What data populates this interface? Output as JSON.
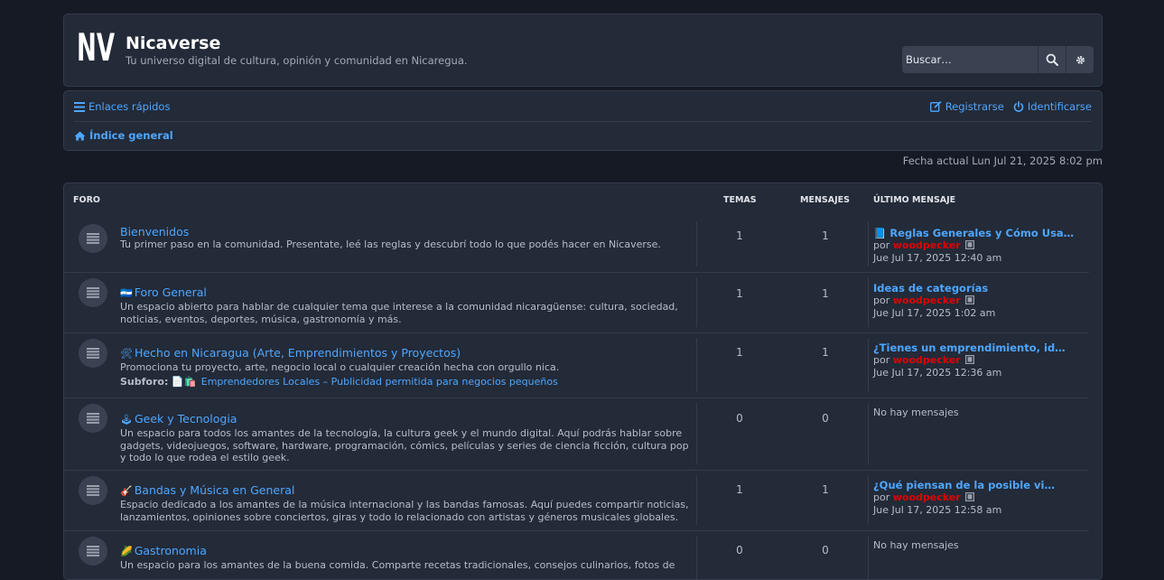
{
  "header": {
    "logo_text": "NV",
    "site_title": "Nicaverse",
    "site_description": "Tu universo digital de cultura, opinión y comunidad en Nicaregua.",
    "search_placeholder": "Buscar…"
  },
  "navbar": {
    "quick_links": "Enlaces rápidos",
    "register": "Registrarse",
    "login": "Identificarse",
    "breadcrumb": "Índice general"
  },
  "current_time": "Fecha actual Lun Jul 21, 2025 8:02 pm",
  "table": {
    "col_forum": "FORO",
    "col_topics": "TEMAS",
    "col_posts": "MENSAJES",
    "col_last": "ÚLTIMO MENSAJE"
  },
  "forums": [
    {
      "emoji": "",
      "title": "Bienvenidos",
      "description": "Tu primer paso en la comunidad. Presentate, leé las reglas y descubrí todo lo que podés hacer en Nicaverse.",
      "topics": "1",
      "posts": "1",
      "last_title": "📘 Reglas Generales y Cómo Usa…",
      "by": "por",
      "last_author": "woodpecker",
      "last_date": "Jue Jul 17, 2025 12:40 am"
    },
    {
      "emoji": "🇳🇮",
      "title": "Foro General",
      "description": "Un espacio abierto para hablar de cualquier tema que interese a la comunidad nicaragüense: cultura, sociedad, noticias, eventos, deportes, música, gastronomía y más.",
      "topics": "1",
      "posts": "1",
      "last_title": "Ideas de categorías",
      "by": "por",
      "last_author": "woodpecker",
      "last_date": "Jue Jul 17, 2025 1:02 am"
    },
    {
      "emoji": "🛠",
      "title": "Hecho en Nicaragua (Arte, Emprendimientos y Proyectos)",
      "description": "Promociona tu proyecto, arte, negocio local o cualquier creación hecha con orgullo nica.",
      "subforum_label": "Subforo:",
      "subforum_emoji": "📄🛍️",
      "subforum_link": "Emprendedores Locales – Publicidad permitida para negocios pequeños",
      "topics": "1",
      "posts": "1",
      "last_title": "¿Tienes un emprendimiento, id…",
      "by": "por",
      "last_author": "woodpecker",
      "last_date": "Jue Jul 17, 2025 12:36 am"
    },
    {
      "emoji": "🕹",
      "title": "Geek y Tecnologia",
      "description": "Un espacio para todos los amantes de la tecnología, la cultura geek y el mundo digital. Aquí podrás hablar sobre gadgets, videojuegos, software, hardware, programación, cómics, películas y series de ciencia ficción, cultura pop y todo lo que rodea el estilo geek.",
      "topics": "0",
      "posts": "0",
      "no_posts": "No hay mensajes"
    },
    {
      "emoji": "🎸",
      "title": "Bandas y Música en General",
      "description": "Espacio dedicado a los amantes de la música internacional y las bandas famosas. Aquí puedes compartir noticias, lanzamientos, opiniones sobre conciertos, giras y todo lo relacionado con artistas y géneros musicales globales.",
      "topics": "1",
      "posts": "1",
      "last_title": "¿Qué piensan de la posible vi…",
      "by": "por",
      "last_author": "woodpecker",
      "last_date": "Jue Jul 17, 2025 12:58 am"
    },
    {
      "emoji": "🌽",
      "title": "Gastronomia",
      "description": "Un espacio para los amantes de la buena comida. Comparte recetas tradicionales, consejos culinarios, fotos de",
      "topics": "0",
      "posts": "0",
      "no_posts": "No hay mensajes"
    }
  ]
}
